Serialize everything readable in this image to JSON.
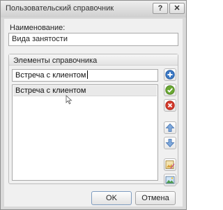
{
  "window": {
    "title": "Пользовательский справочник",
    "help_label": "?",
    "close_label": "✕"
  },
  "name_section": {
    "label": "Наименование:",
    "value": "Вида занятости"
  },
  "elements_group": {
    "title": "Элементы справочника",
    "input_value": "Встреча с клиентом",
    "items": [
      {
        "label": "Встреча с клиентом"
      }
    ]
  },
  "side_buttons": [
    {
      "name": "add-item-button",
      "icon": "plus-icon",
      "color": "#3b78c4"
    },
    {
      "name": "confirm-item-button",
      "icon": "check-icon",
      "color": "#6aa832"
    },
    {
      "name": "delete-item-button",
      "icon": "close-icon",
      "color": "#d33a2c"
    },
    {
      "name": "move-up-button",
      "icon": "arrow-up-icon",
      "color": "#5d8fcf"
    },
    {
      "name": "move-down-button",
      "icon": "arrow-down-icon",
      "color": "#5d8fcf"
    },
    {
      "name": "edit-image-button",
      "icon": "edit-picture-icon",
      "color": "#d9a13c"
    },
    {
      "name": "picture-button",
      "icon": "picture-icon",
      "color": "#4a9c4a"
    }
  ],
  "footer": {
    "ok_label": "OK",
    "cancel_label": "Отмена"
  }
}
